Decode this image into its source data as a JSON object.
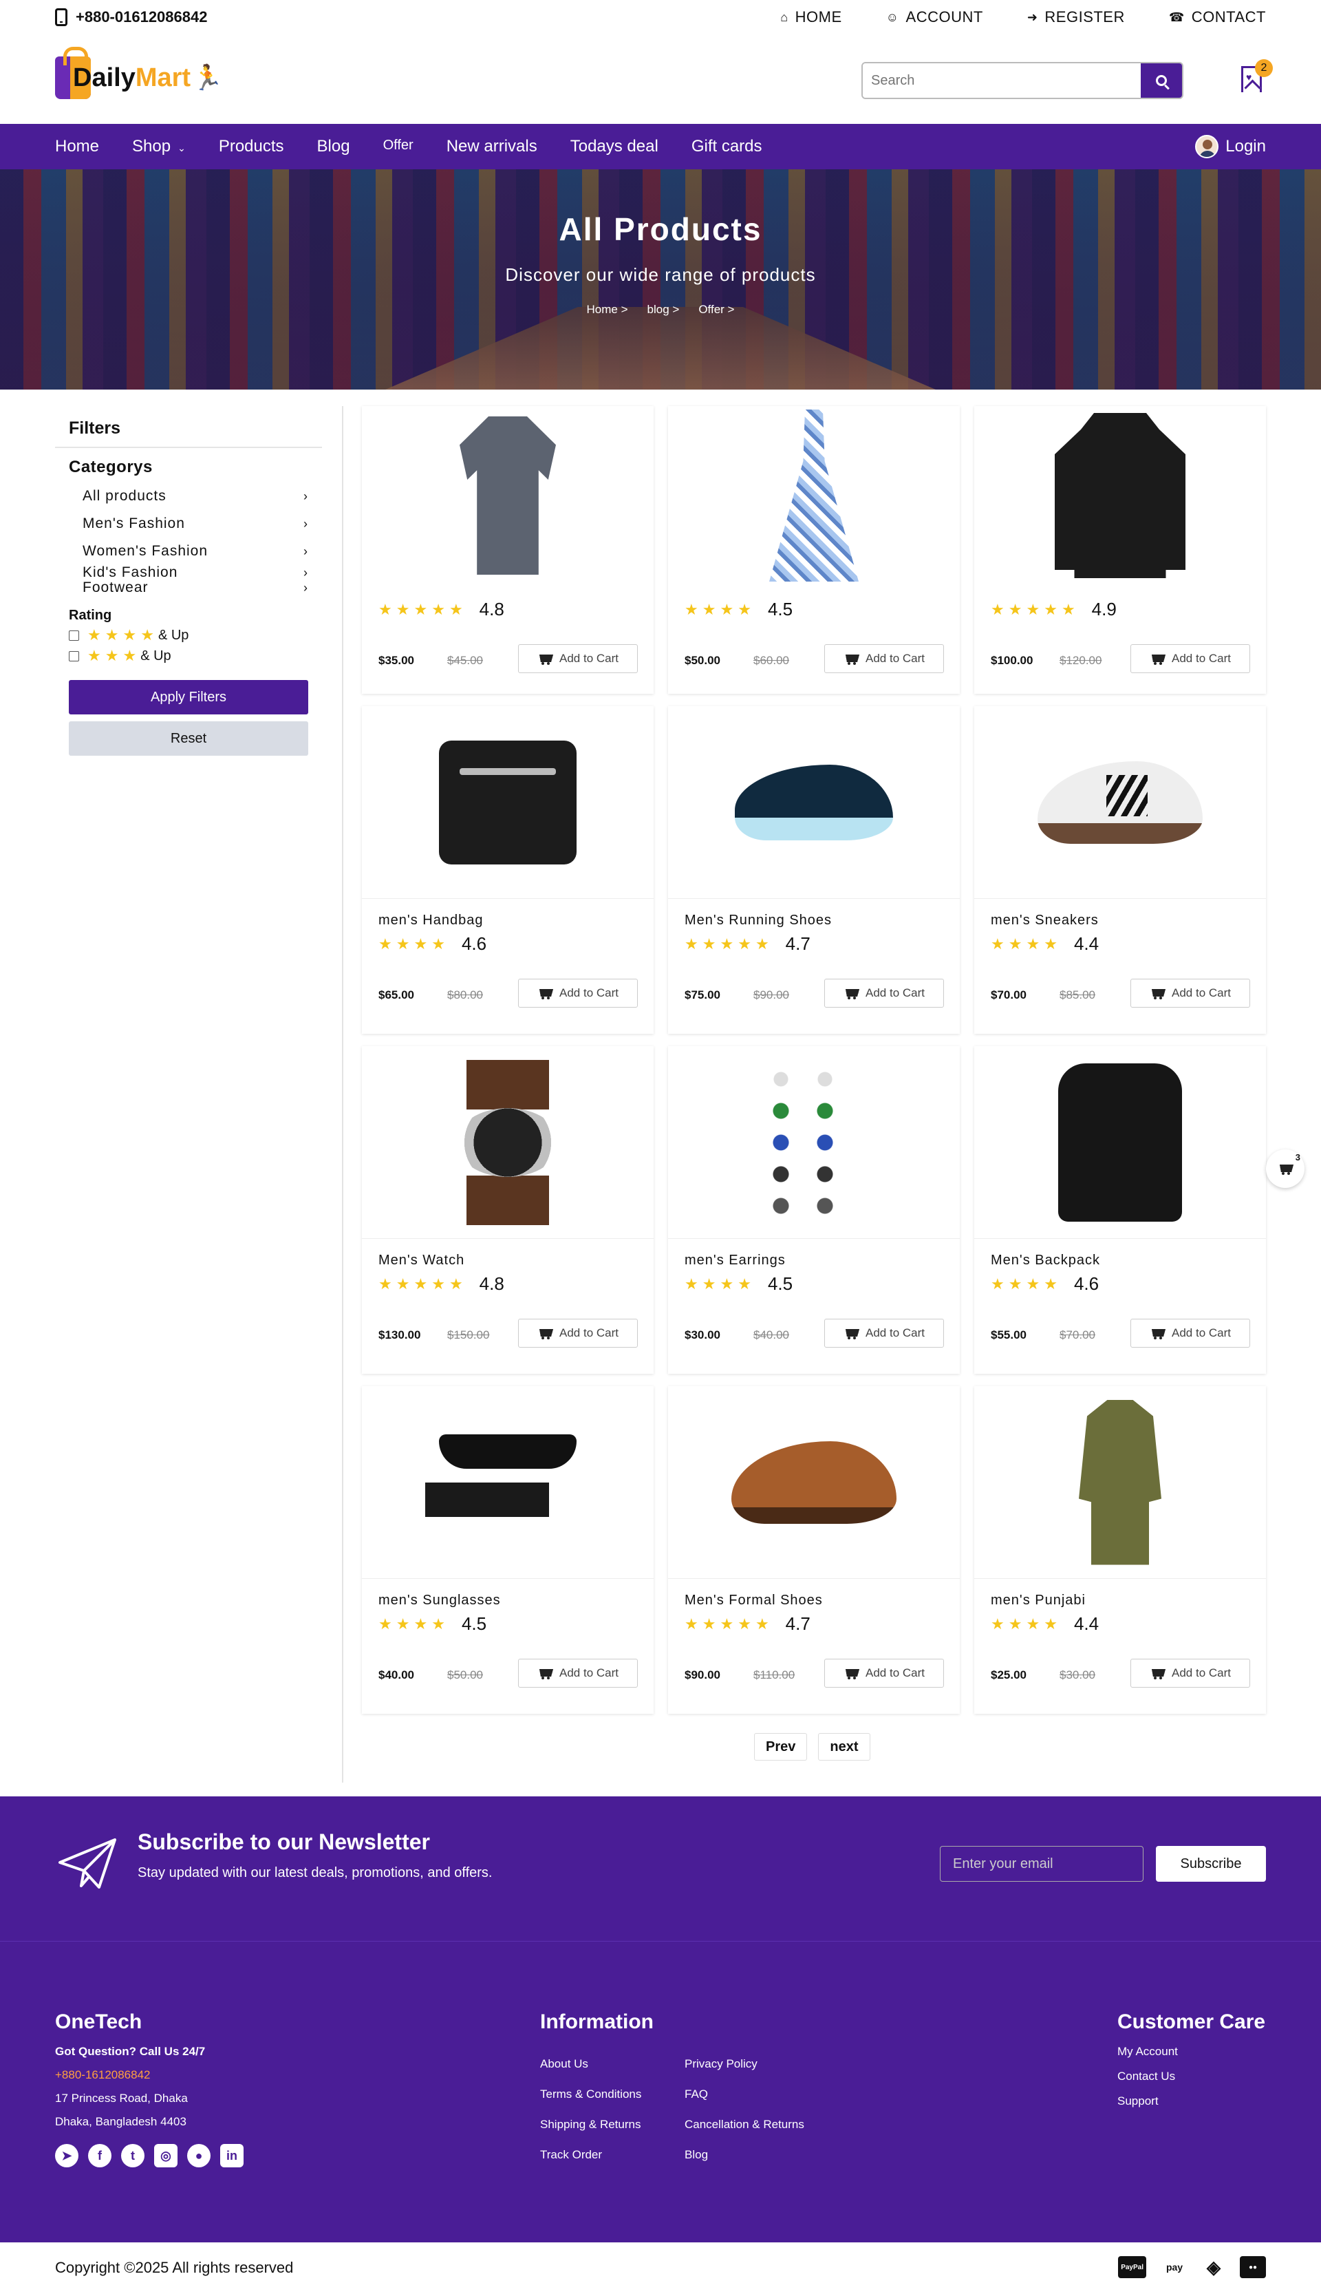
{
  "topbar": {
    "phone": "+880-01612086842",
    "links": [
      {
        "label": "HOME",
        "icon": "home-icon"
      },
      {
        "label": "ACCOUNT",
        "icon": "user-icon"
      },
      {
        "label": "REGISTER",
        "icon": "sign-in-icon"
      },
      {
        "label": "CONTACT",
        "icon": "contact-icon"
      }
    ]
  },
  "header": {
    "logo_part1": "Daily",
    "logo_part2": "Mart",
    "search_placeholder": "Search",
    "wishlist_count": "2"
  },
  "nav": {
    "links": [
      "Home",
      "Shop",
      "Products",
      "Blog",
      "Offer",
      "New arrivals",
      "Todays deal",
      "Gift cards"
    ],
    "login": "Login"
  },
  "hero": {
    "title": "All Products",
    "subtitle": "Discover our wide range of products",
    "breadcrumbs": [
      "Home >",
      "blog >",
      "Offer >"
    ]
  },
  "sidebar": {
    "filters_title": "Filters",
    "categories_title": "Categorys",
    "categories": [
      "All products",
      "Men's Fashion",
      "Women's Fashion"
    ],
    "kids_line1": "Kid's Fashion",
    "kids_line2": "Footwear",
    "rating_title": "Rating",
    "rating_suffix": "& Up",
    "apply_label": "Apply Filters",
    "reset_label": "Reset"
  },
  "products": [
    {
      "name": "",
      "rating": "4.8",
      "price": "$35.00",
      "old_price": "$45.00",
      "stars": 5,
      "image": "polo-shirt"
    },
    {
      "name": "",
      "rating": "4.5",
      "price": "$50.00",
      "old_price": "$60.00",
      "stars": 4,
      "image": "floral-dress"
    },
    {
      "name": "",
      "rating": "4.9",
      "price": "$100.00",
      "old_price": "$120.00",
      "stars": 5,
      "image": "leather-jacket"
    },
    {
      "name": "men's Handbag",
      "rating": "4.6",
      "price": "$65.00",
      "old_price": "$80.00",
      "stars": 4,
      "image": "handbag"
    },
    {
      "name": "Men's Running Shoes",
      "rating": "4.7",
      "price": "$75.00",
      "old_price": "$90.00",
      "stars": 5,
      "image": "running-shoe"
    },
    {
      "name": "men's Sneakers",
      "rating": "4.4",
      "price": "$70.00",
      "old_price": "$85.00",
      "stars": 4,
      "image": "sneaker"
    },
    {
      "name": "Men's Watch",
      "rating": "4.8",
      "price": "$130.00",
      "old_price": "$150.00",
      "stars": 5,
      "image": "watch"
    },
    {
      "name": "men's Earrings",
      "rating": "4.5",
      "price": "$30.00",
      "old_price": "$40.00",
      "stars": 4,
      "image": "earrings"
    },
    {
      "name": "Men's Backpack",
      "rating": "4.6",
      "price": "$55.00",
      "old_price": "$70.00",
      "stars": 4,
      "image": "backpack"
    },
    {
      "name": "men's Sunglasses",
      "rating": "4.5",
      "price": "$40.00",
      "old_price": "$50.00",
      "stars": 4,
      "image": "sunglasses"
    },
    {
      "name": "Men's Formal Shoes",
      "rating": "4.7",
      "price": "$90.00",
      "old_price": "$110.00",
      "stars": 5,
      "image": "formal-shoe"
    },
    {
      "name": "men's Punjabi",
      "rating": "4.4",
      "price": "$25.00",
      "old_price": "$30.00",
      "stars": 4,
      "image": "punjabi"
    }
  ],
  "add_to_cart_label": "Add to Cart",
  "pagination": {
    "prev": "Prev",
    "next": "next"
  },
  "cart_float_count": "3",
  "newsletter": {
    "title": "Subscribe to our Newsletter",
    "subtitle": "Stay updated with our latest deals, promotions, and offers.",
    "placeholder": "Enter your email",
    "button": "Subscribe"
  },
  "footer": {
    "brand": "OneTech",
    "question": "Got Question? Call Us 24/7",
    "phone": "+880-1612086842",
    "address1": "17 Princess Road, Dhaka",
    "address2": "Dhaka, Bangladesh 4403",
    "info_title": "Information",
    "info_col1": [
      "About Us",
      "Terms & Conditions",
      "Shipping & Returns",
      "Track Order"
    ],
    "info_col2": [
      "Privacy Policy",
      "FAQ",
      "Cancellation & Returns",
      "Blog"
    ],
    "care_title": "Customer Care",
    "care_links": [
      "My Account",
      "Contact Us",
      "Support"
    ],
    "socials": [
      "telegram-icon",
      "facebook-icon",
      "twitter-icon",
      "instagram-icon",
      "github-icon",
      "linkedin-icon"
    ]
  },
  "bottom": {
    "copyright": "Copyright ©2025 All rights reserved",
    "payments": [
      "PayPal",
      "pay",
      "◈",
      "mastercard"
    ]
  },
  "colors": {
    "brand": "#4a1d96",
    "accent": "#f5a623",
    "star": "#f5c51b",
    "phone": "#ff9f40"
  }
}
